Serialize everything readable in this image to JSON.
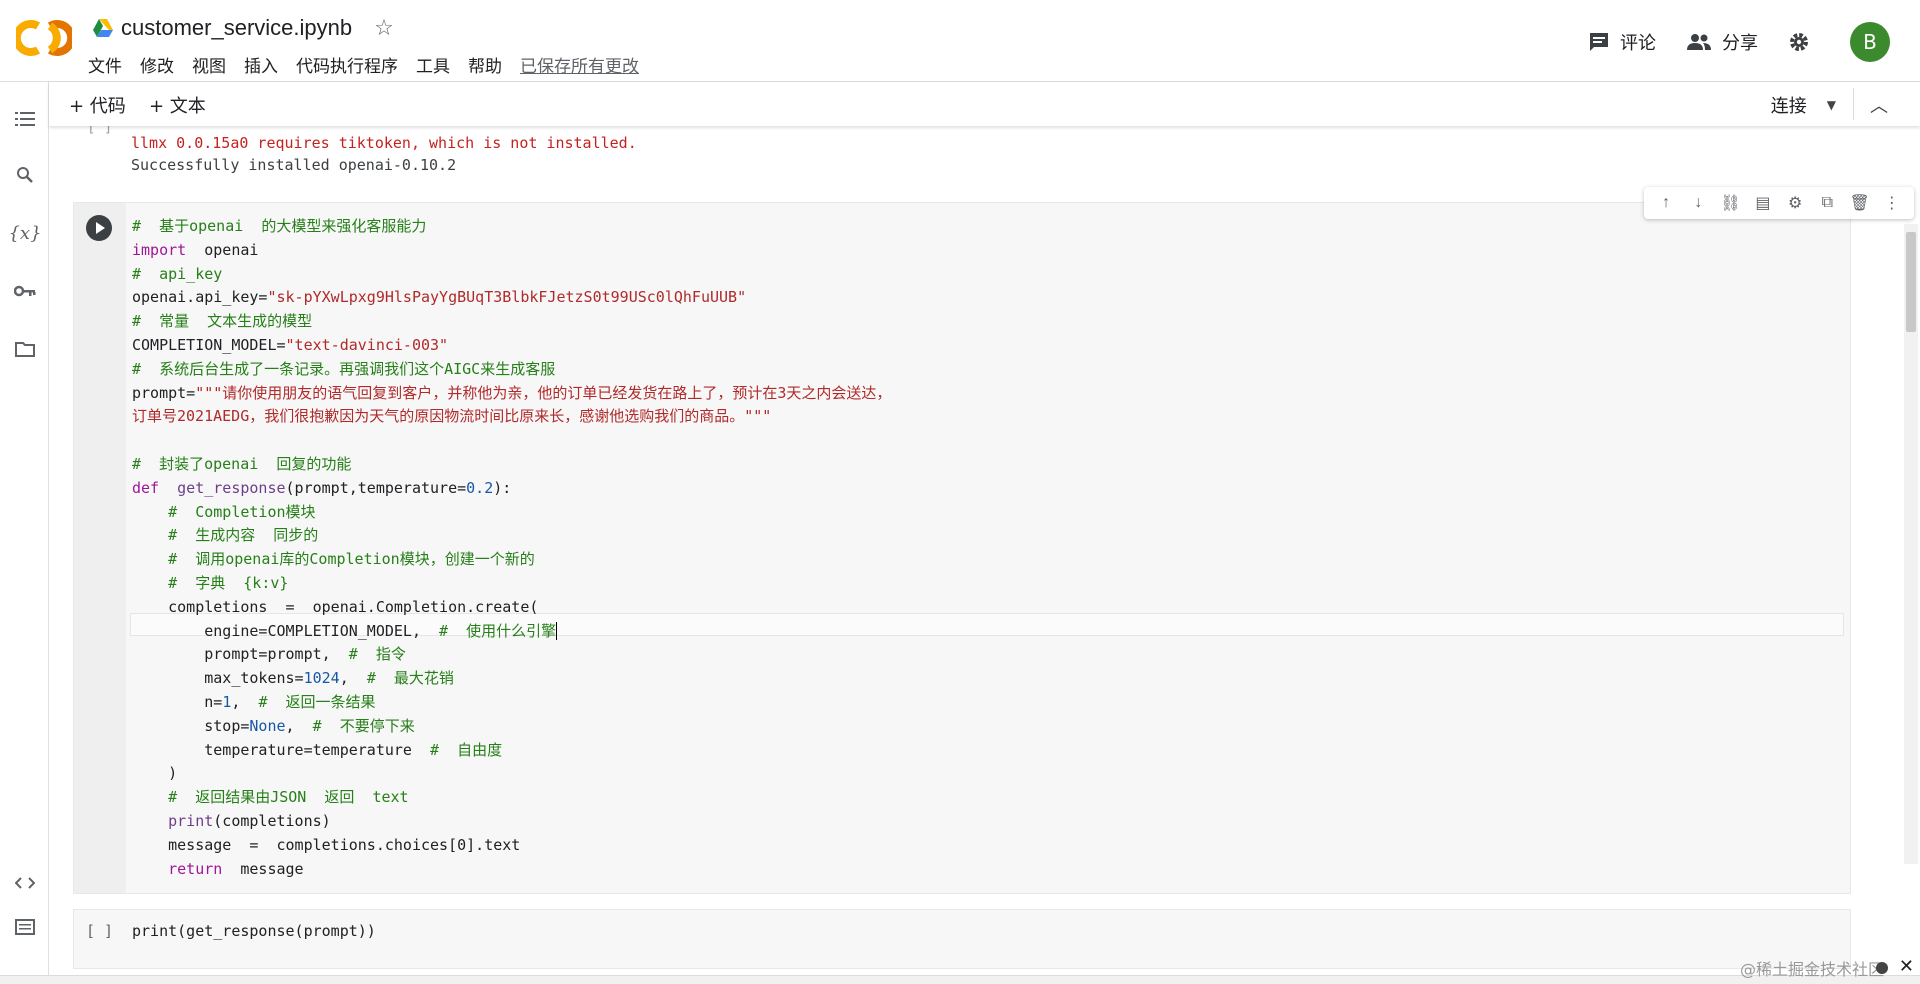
{
  "header": {
    "file_title": "customer_service.ipynb",
    "menu": [
      "文件",
      "修改",
      "视图",
      "插入",
      "代码执行程序",
      "工具",
      "帮助"
    ],
    "saved_status": "已保存所有更改",
    "comment_label": "评论",
    "share_label": "分享",
    "avatar_letter": "B",
    "accent_color": "#f9ab00",
    "avatar_color": "#3c8a2e"
  },
  "toolbar": {
    "add_code": "+ 代码",
    "add_text": "+ 文本",
    "connect": "连接"
  },
  "output": {
    "bracket": "[ ]",
    "lines": [
      "llmx 0.0.15a0 requires tiktoken, which is not installed.",
      "Successfully installed openai-0.10.2"
    ]
  },
  "cell1": {
    "line1": "#  基于openai  的大模型来强化客服能力",
    "line2_kw": "import",
    "line2_rest": "  openai",
    "line3": "#  api_key",
    "line4_a": "openai.api_key=",
    "line4_b": "\"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\"",
    "line5": "#  常量  文本生成的模型",
    "line6_a": "COMPLETION_MODEL=",
    "line6_b": "\"text-davinci-003\"",
    "line7": "#  系统后台生成了一条记录。再强调我们这个AIGC来生成客服",
    "line8_a": "prompt=",
    "line8_b": "\"\"\"请你使用朋友的语气回复到客户，并称他为亲，他的订单已经发货在路上了，预计在3天之内会送达，",
    "line9": "订单号2021AEDG，我们很抱歉因为天气的原因物流时间比原来长，感谢他选购我们的商品。\"\"\"",
    "line11": "#  封装了openai  回复的功能",
    "line12_kw": "def",
    "line12_fn": "  get_response",
    "line12_rest": "(prompt,temperature=",
    "line12_num": "0.2",
    "line12_end": "):",
    "line13": "    #  Completion模块",
    "line14": "    #  生成内容  同步的",
    "line15": "    #  调用openai库的Completion模块，创建一个新的",
    "line16": "    #  字典  {k:v}",
    "line17": "    completions  =  openai.Completion.create(",
    "line18_a": "        engine=COMPLETION_MODEL,  ",
    "line18_b": "#  使用什么引擎",
    "line19_a": "        prompt=prompt,  ",
    "line19_b": "#  指令",
    "line20_a": "        max_tokens=",
    "line20_num": "1024",
    "line20_c": ",  ",
    "line20_b": "#  最大花销",
    "line21_a": "        n=",
    "line21_num": "1",
    "line21_c": ",  ",
    "line21_b": "#  返回一条结果",
    "line22_a": "        stop=",
    "line22_kw": "None",
    "line22_c": ",  ",
    "line22_b": "#  不要停下来",
    "line23_a": "        temperature=temperature  ",
    "line23_b": "#  自由度",
    "line24": "    )",
    "line25": "    #  返回结果由JSON  返回  text",
    "line26_fn": "    print",
    "line26_rest": "(completions)",
    "line27": "    message  =  completions.choices[0].text",
    "line28_kw": "    return",
    "line28_rest": "  message"
  },
  "cell2": {
    "bracket": "[ ]",
    "code_fn": "print",
    "code_rest": "(get_response(prompt))"
  },
  "watermark": "@稀土掘金技术社区"
}
